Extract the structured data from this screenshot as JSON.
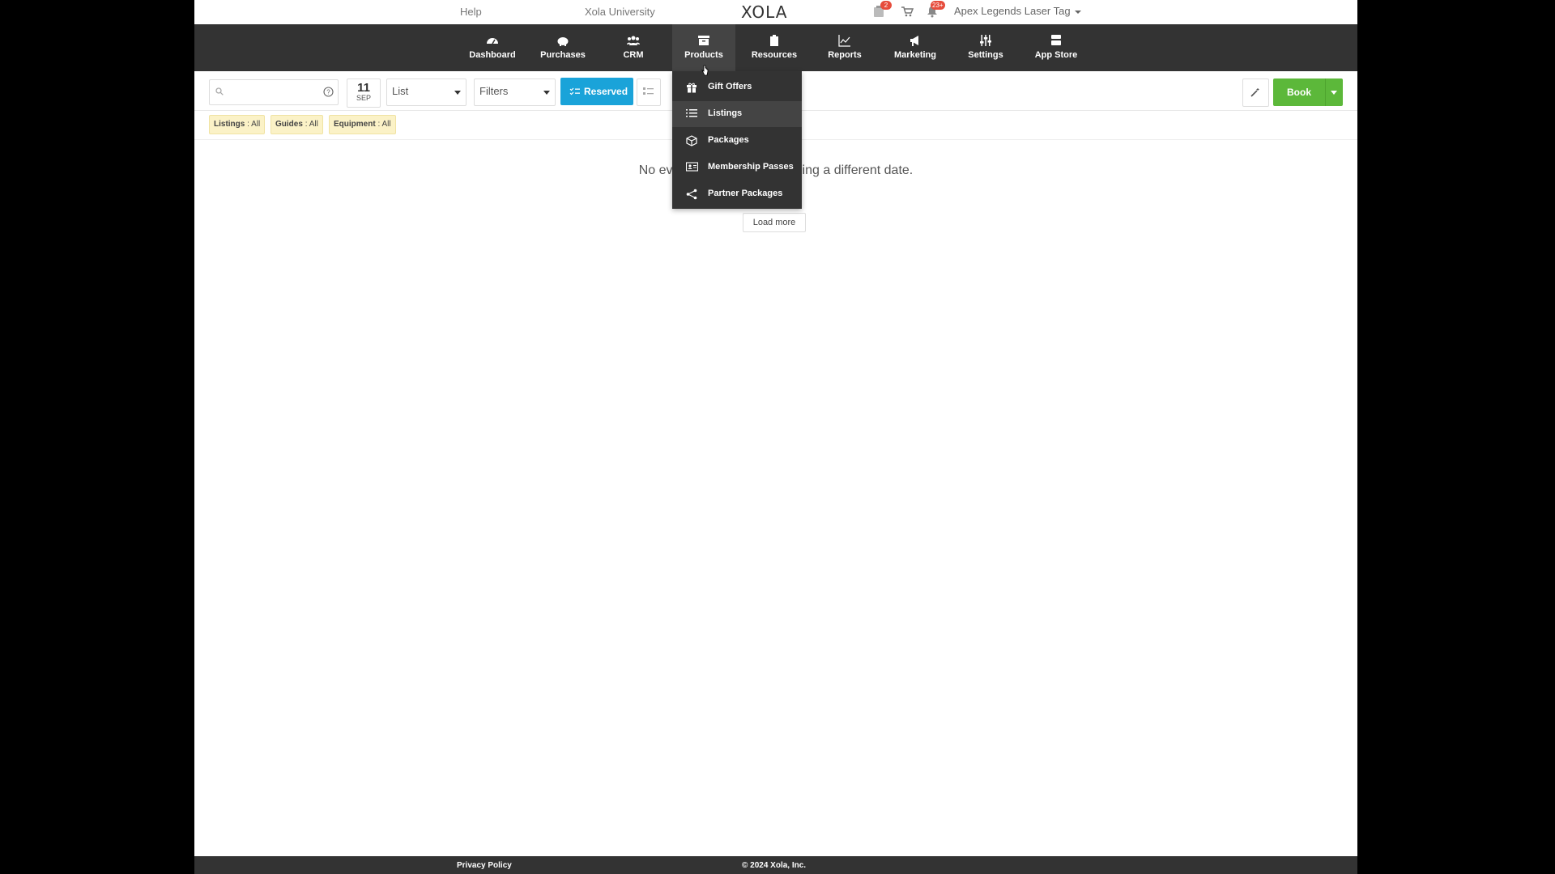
{
  "topbar": {
    "help": "Help",
    "university": "Xola University",
    "logo": "XOLA",
    "notifications": [
      {
        "icon": "clipboard-icon",
        "badge": "2"
      },
      {
        "icon": "cart-icon",
        "badge": ""
      },
      {
        "icon": "bell-icon",
        "badge": "23+"
      }
    ],
    "account": "Apex Legends Laser Tag"
  },
  "nav": {
    "active": "Products",
    "items": [
      {
        "label": "Dashboard",
        "icon": "speedometer-icon"
      },
      {
        "label": "Purchases",
        "icon": "piggy-bank-icon"
      },
      {
        "label": "CRM",
        "icon": "users-icon"
      },
      {
        "label": "Products",
        "icon": "archive-box-icon"
      },
      {
        "label": "Resources",
        "icon": "clipboard-icon"
      },
      {
        "label": "Reports",
        "icon": "line-chart-icon"
      },
      {
        "label": "Marketing",
        "icon": "megaphone-icon"
      },
      {
        "label": "Settings",
        "icon": "sliders-icon"
      },
      {
        "label": "App Store",
        "icon": "store-icon"
      }
    ]
  },
  "products_menu": {
    "hovered": "Listings",
    "items": [
      {
        "label": "Gift Offers",
        "icon": "gift-icon"
      },
      {
        "label": "Listings",
        "icon": "list-icon"
      },
      {
        "label": "Packages",
        "icon": "package-icon"
      },
      {
        "label": "Membership Passes",
        "icon": "id-card-icon"
      },
      {
        "label": "Partner Packages",
        "icon": "share-icon"
      }
    ]
  },
  "toolbar": {
    "search_placeholder": "",
    "date_day": "11",
    "date_month": "SEP",
    "view_select": "List",
    "filters_select": "Filters",
    "reserved_label": "Reserved",
    "book_label": "Book"
  },
  "filters": [
    {
      "key": "Listings",
      "value": ": All"
    },
    {
      "key": "Guides",
      "value": ": All"
    },
    {
      "key": "Equipment",
      "value": ": All"
    }
  ],
  "main": {
    "empty_left": "No ev",
    "empty_right": "ing a different date.",
    "load_more": "Load more"
  },
  "footer": {
    "privacy": "Privacy Policy",
    "copyright": "© 2024 Xola, Inc."
  },
  "colors": {
    "nav_bg": "#333333",
    "reserved_blue": "#1aa3d9",
    "book_green": "#5cb83a",
    "badge_red": "#e64c3c",
    "chip_yellow": "#fbf2c7"
  }
}
